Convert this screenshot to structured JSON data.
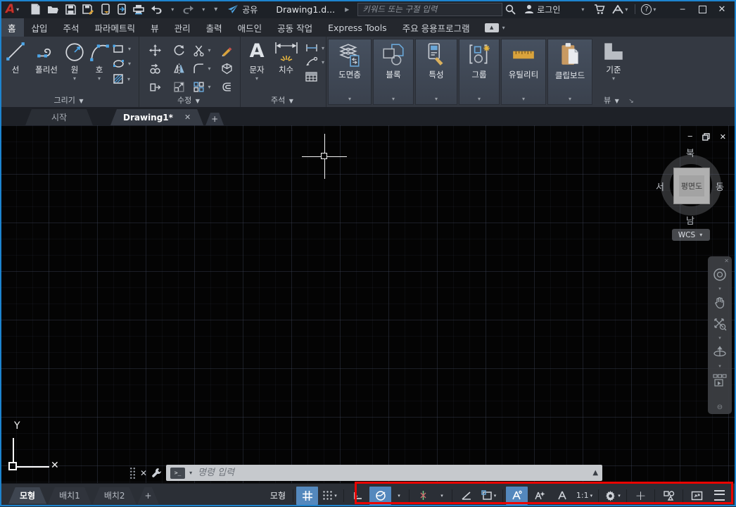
{
  "titlebar": {
    "doc_title": "Drawing1.d...",
    "search_placeholder": "키워드 또는 구절 입력",
    "share_label": "공유",
    "login_label": "로그인"
  },
  "ribbon": {
    "tabs": [
      "홈",
      "삽입",
      "주석",
      "파라메트릭",
      "뷰",
      "관리",
      "출력",
      "애드인",
      "공동 작업",
      "Express Tools",
      "주요 응용프로그램"
    ],
    "active_tab": "홈",
    "panels": {
      "draw": {
        "title": "그리기",
        "line": "선",
        "polyline": "폴리선",
        "circle": "원",
        "arc": "호"
      },
      "modify": {
        "title": "수정"
      },
      "annotate": {
        "title": "주석",
        "text": "문자",
        "dimension": "치수",
        "text_glyph": "A"
      },
      "layers": {
        "label": "도면층"
      },
      "block": {
        "label": "블록"
      },
      "properties": {
        "label": "특성"
      },
      "groups": {
        "label": "그룹"
      },
      "utilities": {
        "label": "유틸리티"
      },
      "clipboard": {
        "label": "클립보드"
      },
      "view": {
        "title": "뷰",
        "base_label": "기준"
      }
    }
  },
  "file_tabs": {
    "start": "시작",
    "drawing": "Drawing1*"
  },
  "canvas": {
    "viewcube": {
      "north": "북",
      "south": "남",
      "west": "서",
      "east": "동",
      "center": "평면도",
      "wcs_label": "WCS"
    }
  },
  "command_line": {
    "prompt_placeholder": "명령 입력",
    "prompt_glyph": ">_"
  },
  "layout_tabs": {
    "model": "모형",
    "layout1": "배치1",
    "layout2": "배치2",
    "add": "+"
  },
  "status_bar": {
    "model_label": "모형",
    "scale_label": "1:1"
  },
  "icons": {
    "caret": "▾",
    "panel_caret": "▼",
    "launcher": "↘",
    "tab_arrow": "▶",
    "close": "✕",
    "minimize": "─",
    "plus": "+",
    "angle": "∠",
    "ortho": "∟",
    "help": "?",
    "collapse_up": "▲",
    "restore_up": "▲",
    "text_A": "A"
  },
  "colors": {
    "window_border": "#1d84cf",
    "active_toggle": "#5488bd",
    "annotation_red": "#e90400",
    "logo_red": "#c5342c"
  }
}
